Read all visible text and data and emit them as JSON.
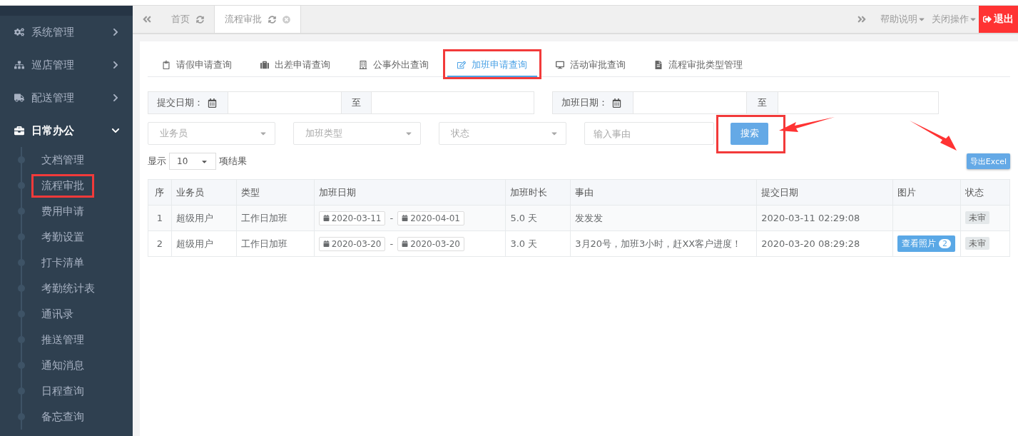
{
  "sidebar": {
    "items": [
      {
        "label": "系统管理",
        "expanded": false
      },
      {
        "label": "巡店管理",
        "expanded": false
      },
      {
        "label": "配送管理",
        "expanded": false
      },
      {
        "label": "日常办公",
        "expanded": true,
        "children": [
          {
            "label": "文档管理",
            "highlighted": false
          },
          {
            "label": "流程审批",
            "highlighted": true
          },
          {
            "label": "费用申请",
            "highlighted": false
          },
          {
            "label": "考勤设置",
            "highlighted": false
          },
          {
            "label": "打卡清单",
            "highlighted": false
          },
          {
            "label": "考勤统计表",
            "highlighted": false
          },
          {
            "label": "通讯录",
            "highlighted": false
          },
          {
            "label": "推送管理",
            "highlighted": false
          },
          {
            "label": "通知消息",
            "highlighted": false
          },
          {
            "label": "日程查询",
            "highlighted": false
          },
          {
            "label": "备忘查询",
            "highlighted": false
          }
        ]
      }
    ]
  },
  "page_tabs": [
    {
      "label": "首页",
      "selected": false,
      "closable": false
    },
    {
      "label": "流程审批",
      "selected": true,
      "closable": true
    }
  ],
  "top_right": {
    "help_menu": "帮助说明",
    "close_menu": "关闭操作",
    "logout": "退出"
  },
  "query_tabs": [
    {
      "label": "请假申请查询",
      "selected": false,
      "highlighted": false
    },
    {
      "label": "出差申请查询",
      "selected": false,
      "highlighted": false
    },
    {
      "label": "公事外出查询",
      "selected": false,
      "highlighted": false
    },
    {
      "label": "加班申请查询",
      "selected": true,
      "highlighted": true
    },
    {
      "label": "活动审批查询",
      "selected": false,
      "highlighted": false
    },
    {
      "label": "流程审批类型管理",
      "selected": false,
      "highlighted": false
    }
  ],
  "date_ranges": [
    {
      "label": "提交日期：",
      "separator": "至"
    },
    {
      "label": "加班日期：",
      "separator": "至"
    }
  ],
  "selects": [
    {
      "placeholder": "业务员"
    },
    {
      "placeholder": "加班类型"
    },
    {
      "placeholder": "状态"
    }
  ],
  "reason_field": {
    "placeholder": "输入事由"
  },
  "search_button": {
    "label": "搜索",
    "highlighted": true,
    "arrow": true
  },
  "export_button": {
    "label": "导出Excel",
    "arrow": true
  },
  "page_size": {
    "prefix": "显示",
    "value": "10",
    "suffix": "项结果"
  },
  "table": {
    "columns": [
      "序",
      "业务员",
      "类型",
      "加班日期",
      "加班时长",
      "事由",
      "提交日期",
      "图片",
      "状态"
    ],
    "rows": [
      {
        "index": "1",
        "user": "超级用户",
        "type": "工作日加班",
        "date_from": "2020-03-11",
        "date_sep": "-",
        "date_to": "2020-04-01",
        "duration": "5.0 天",
        "reason": "发发发",
        "submitted": "2020-03-11 02:29:08",
        "status": "未审"
      },
      {
        "index": "2",
        "user": "超级用户",
        "type": "工作日加班",
        "date_from": "2020-03-20",
        "date_sep": "-",
        "date_to": "2020-03-20",
        "duration": "3.0 天",
        "reason": "3月20号，加班3小时，赶XX客户进度！",
        "submitted": "2020-03-20 08:29:28",
        "photo": {
          "label": "查看照片",
          "count": "2"
        },
        "status": "未审"
      }
    ]
  }
}
